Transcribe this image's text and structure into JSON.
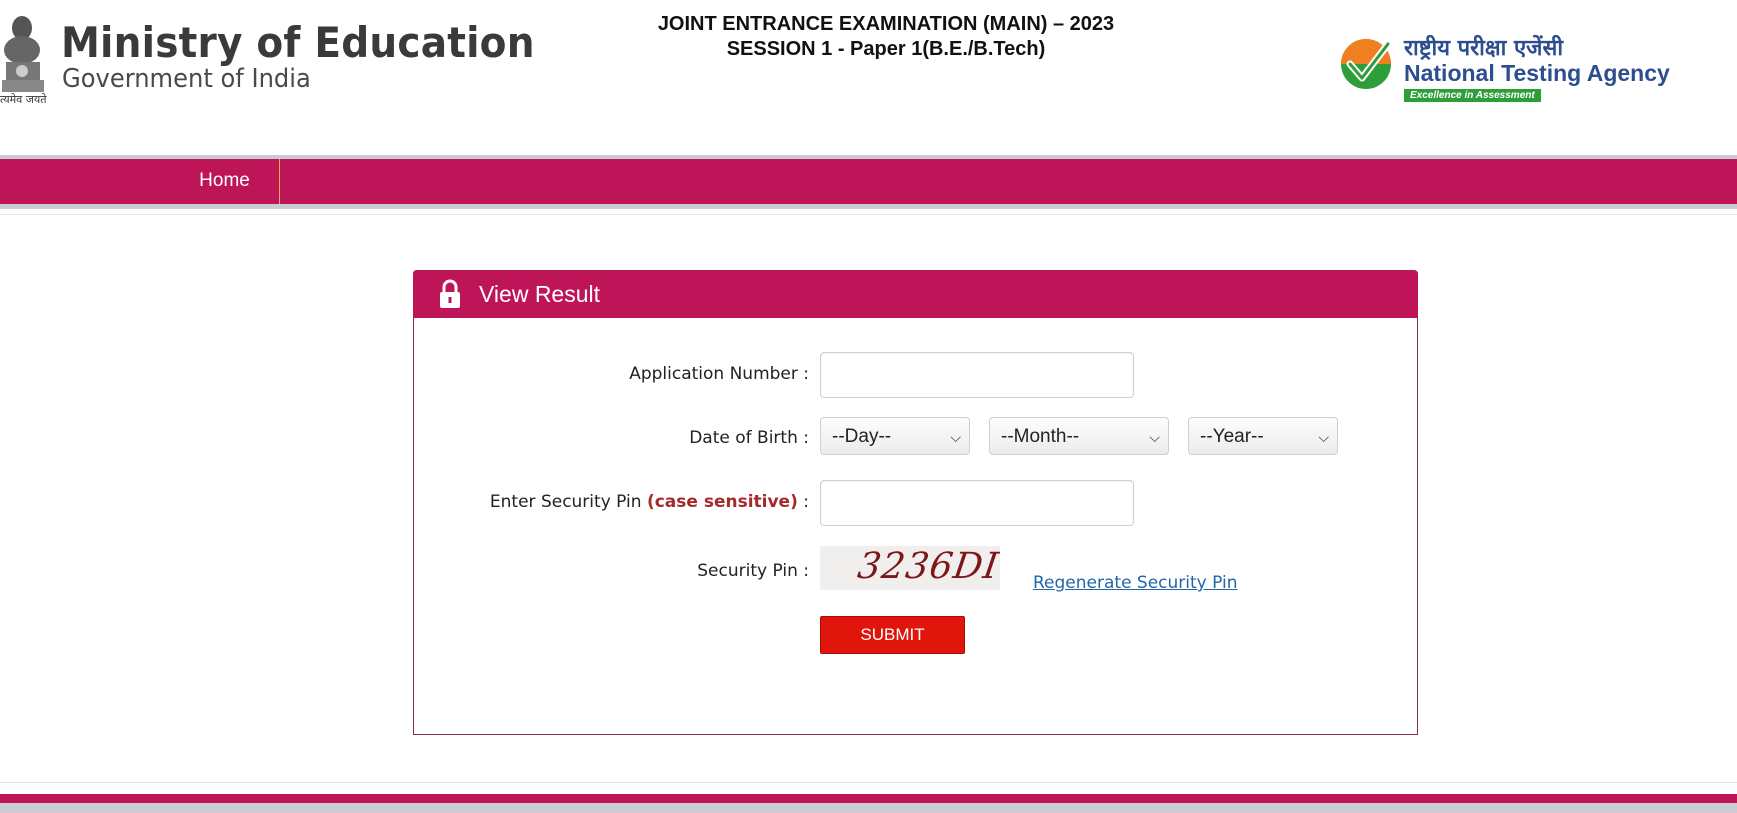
{
  "header": {
    "ministry_title": "Ministry of Education",
    "ministry_sub": "Government of India",
    "emblem_motto": "त्यमेव जयते",
    "exam_line1": "JOINT ENTRANCE EXAMINATION (MAIN) – 2023",
    "exam_line2": "SESSION 1 - Paper 1(B.E./B.Tech)",
    "nta_hindi": "राष्ट्रीय परीक्षा एजेंसी",
    "nta_name": "National Testing Agency",
    "nta_tagline": "Excellence in Assessment"
  },
  "nav": {
    "home_label": "Home"
  },
  "form": {
    "panel_title": "View Result",
    "application_label": "Application Number :",
    "dob_label": "Date of Birth :",
    "security_pin_label": "Enter Security Pin",
    "case_sensitive_note": "(case sensitive)",
    "colon": ":",
    "security_pin_display_label": "Security Pin :",
    "day_select": "--Day--",
    "month_select": "--Month--",
    "year_select": "--Year--",
    "captcha_value": "3236DI",
    "regenerate_label": "Regenerate Security Pin",
    "submit_label": "SUBMIT",
    "application_value": "",
    "security_pin_value": ""
  },
  "colors": {
    "brand": "#be1558",
    "submit": "#e0160d",
    "link": "#2166a8"
  }
}
